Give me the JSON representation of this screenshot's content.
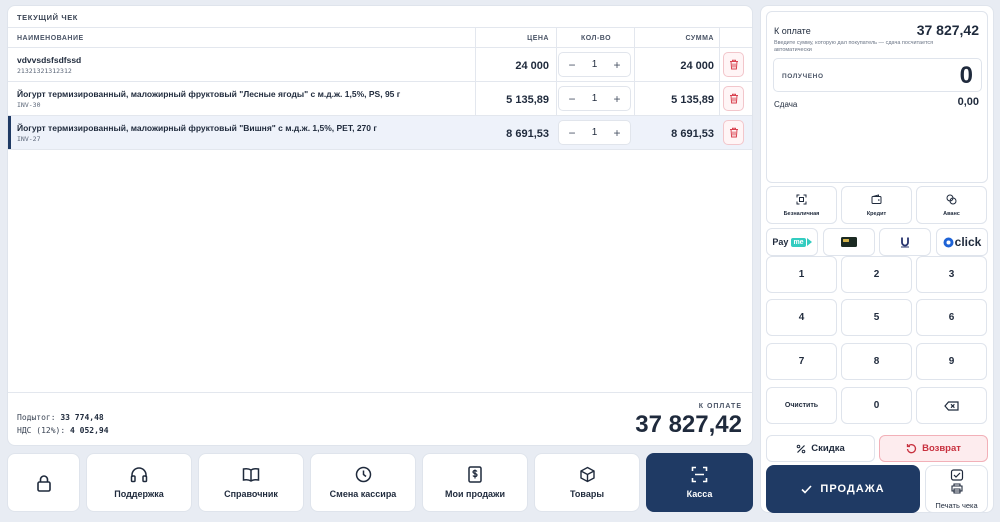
{
  "receipt": {
    "title": "ТЕКУЩИЙ ЧЕК",
    "columns": {
      "name": "НАИМЕНОВАНИЕ",
      "price": "ЦЕНА",
      "qty": "КОЛ-ВО",
      "sum": "СУММА"
    },
    "items": [
      {
        "name": "vdvvsdsfsdfssd",
        "code": "21321321312312",
        "price": "24 000",
        "qty": "1",
        "sum": "24 000"
      },
      {
        "name": "Йогурт термизированный, маложирный фруктовый \"Лесные ягоды\" с м.д.ж. 1,5%, PS, 95 г",
        "code": "INV-30",
        "price": "5 135,89",
        "qty": "1",
        "sum": "5 135,89"
      },
      {
        "name": "Йогурт термизированный, маложирный фруктовый \"Вишня\" с м.д.ж. 1,5%, PET, 270 г",
        "code": "INV-27",
        "price": "8 691,53",
        "qty": "1",
        "sum": "8 691,53"
      }
    ],
    "subtotal_label": "Подытог:",
    "subtotal": "33 774,48",
    "vat_label": "НДС (12%):",
    "vat": "4 052,94",
    "pay_label": "К ОПЛАТЕ",
    "pay_total": "37 827,42"
  },
  "nav": {
    "support": "Поддержка",
    "reference": "Справочник",
    "change_cashier": "Смена кассира",
    "my_sales": "Мои продажи",
    "goods": "Товары",
    "register": "Касса"
  },
  "payment": {
    "label": "К оплате",
    "amount": "37 827,42",
    "hint": "Введите сумму, которую дал покупатель — сдача посчитается автоматически",
    "received_label": "ПОЛУЧЕНО",
    "received_value": "0",
    "change_label": "Сдача",
    "change_value": "0,00"
  },
  "methods": {
    "cashless": "Безналичная",
    "credit": "Кредит",
    "advance": "Аванс"
  },
  "providers": {
    "payme": "Pay",
    "payme_tag": "me",
    "click": "click"
  },
  "keypad": [
    "1",
    "2",
    "3",
    "4",
    "5",
    "6",
    "7",
    "8",
    "9"
  ],
  "keypad_clear": "Очистить",
  "keypad_zero": "0",
  "actions": {
    "discount": "Скидка",
    "return": "Возврат",
    "sell": "ПРОДАЖА",
    "print": "Печать чека"
  },
  "colors": {
    "primary": "#1f3a64",
    "danger": "#c8313f",
    "background": "#e8ecf3"
  }
}
